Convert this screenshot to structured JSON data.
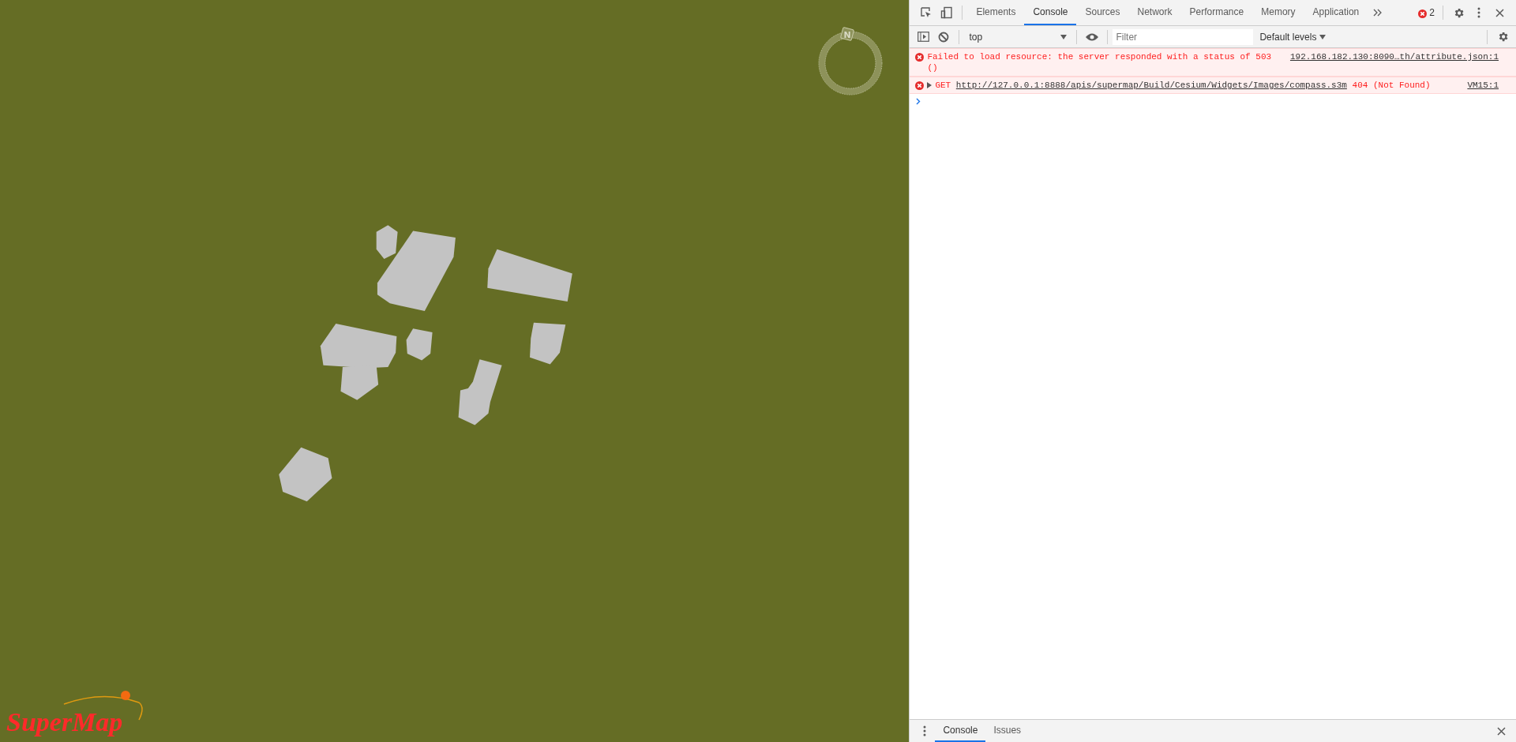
{
  "viewer": {
    "compass": {
      "label": "N"
    },
    "logo": {
      "text": "SuperMap"
    }
  },
  "devtools": {
    "tabs": [
      {
        "label": "Elements",
        "selected": false
      },
      {
        "label": "Console",
        "selected": true
      },
      {
        "label": "Sources",
        "selected": false
      },
      {
        "label": "Network",
        "selected": false
      },
      {
        "label": "Performance",
        "selected": false
      },
      {
        "label": "Memory",
        "selected": false
      },
      {
        "label": "Application",
        "selected": false
      }
    ],
    "error_count": "2",
    "toolbar": {
      "context": "top",
      "filter": {
        "placeholder": "Filter"
      },
      "levels": "Default levels"
    },
    "messages": [
      {
        "kind": "error",
        "text": "Failed to load resource: the server responded with a status of 503 ()",
        "source": "192.168.182.130:8090…th/attribute.json:1"
      },
      {
        "kind": "network",
        "method": "GET",
        "url": "http://127.0.0.1:8888/apis/supermap/Build/Cesium/Widgets/Images/compass.s3m",
        "status": "404 (Not Found)",
        "source": "VM15:1"
      }
    ],
    "drawer_tabs": [
      {
        "label": "Console",
        "selected": true
      },
      {
        "label": "Issues",
        "selected": false
      }
    ]
  }
}
